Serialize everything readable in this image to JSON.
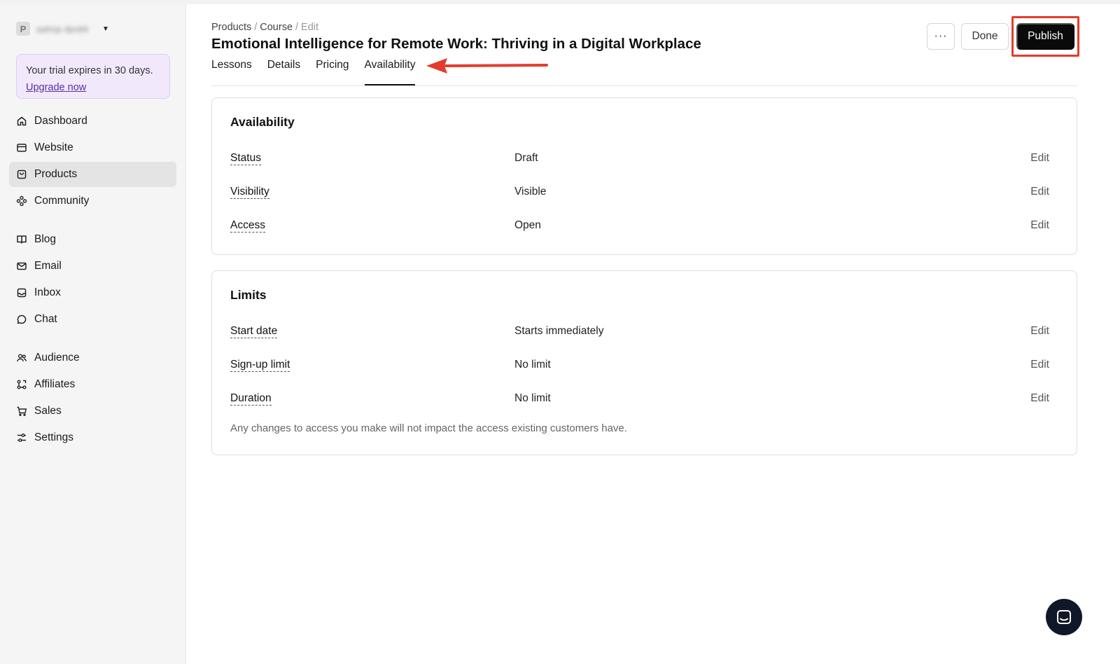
{
  "workspace": {
    "initial": "P",
    "name": "aahop dpokk"
  },
  "trial": {
    "text": "Your trial expires in 30 days.",
    "link": "Upgrade now"
  },
  "sidebar": {
    "group1": [
      {
        "label": "Dashboard",
        "icon": "home-icon"
      },
      {
        "label": "Website",
        "icon": "browser-icon"
      },
      {
        "label": "Products",
        "icon": "bag-icon",
        "active": true
      },
      {
        "label": "Community",
        "icon": "community-icon"
      }
    ],
    "group2": [
      {
        "label": "Blog",
        "icon": "book-icon"
      },
      {
        "label": "Email",
        "icon": "mail-icon"
      },
      {
        "label": "Inbox",
        "icon": "inbox-icon"
      },
      {
        "label": "Chat",
        "icon": "chat-icon"
      }
    ],
    "group3": [
      {
        "label": "Audience",
        "icon": "users-icon"
      },
      {
        "label": "Affiliates",
        "icon": "affiliates-icon"
      },
      {
        "label": "Sales",
        "icon": "cart-icon"
      },
      {
        "label": "Settings",
        "icon": "sliders-icon"
      }
    ]
  },
  "breadcrumb": {
    "products": "Products",
    "course": "Course",
    "current": "Edit"
  },
  "page": {
    "title": "Emotional Intelligence for Remote Work: Thriving in a Digital Workplace"
  },
  "tabs": [
    "Lessons",
    "Details",
    "Pricing",
    "Availability"
  ],
  "actions": {
    "more": "···",
    "done": "Done",
    "publish": "Publish"
  },
  "availability": {
    "title": "Availability",
    "rows": [
      {
        "label": "Status",
        "value": "Draft",
        "action": "Edit"
      },
      {
        "label": "Visibility",
        "value": "Visible",
        "action": "Edit"
      },
      {
        "label": "Access",
        "value": "Open",
        "action": "Edit"
      }
    ]
  },
  "limits": {
    "title": "Limits",
    "rows": [
      {
        "label": "Start date",
        "value": "Starts immediately",
        "action": "Edit"
      },
      {
        "label": "Sign-up limit",
        "value": "No limit",
        "action": "Edit"
      },
      {
        "label": "Duration",
        "value": "No limit",
        "action": "Edit"
      }
    ],
    "note": "Any changes to access you make will not impact the access existing customers have."
  },
  "colors": {
    "highlight": "#e53b2c",
    "trial_bg": "#f1e9fb",
    "link": "#5b2da0",
    "primary": "#0a0a0a"
  }
}
